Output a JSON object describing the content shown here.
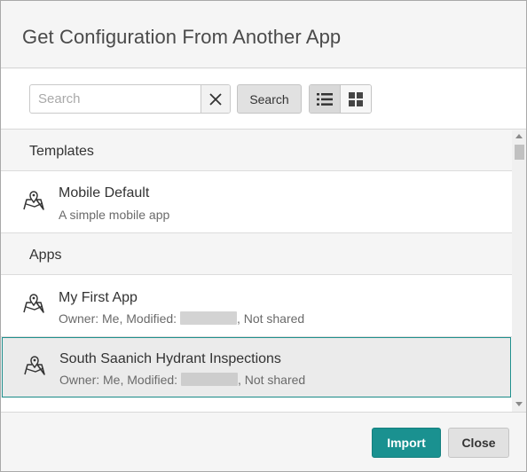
{
  "dialog": {
    "title": "Get Configuration From Another App"
  },
  "toolbar": {
    "search_placeholder": "Search",
    "search_value": "",
    "clear_icon": "close-x-icon",
    "search_label": "Search",
    "view_modes": [
      {
        "name": "list-view-icon",
        "active": true
      },
      {
        "name": "grid-view-icon",
        "active": false
      }
    ]
  },
  "sections": {
    "templates": {
      "label": "Templates",
      "items": [
        {
          "title": "Mobile Default",
          "subtitle": "A simple mobile app",
          "icon": "map-pin-icon"
        }
      ]
    },
    "apps": {
      "label": "Apps",
      "items": [
        {
          "title": "My First  App",
          "owner_prefix": "Owner: Me, Modified: ",
          "modified": "",
          "sharing": ", Not shared",
          "icon": "map-pin-icon",
          "selected": false
        },
        {
          "title": "South Saanich Hydrant Inspections",
          "owner_prefix": "Owner: Me, Modified: ",
          "modified": "",
          "sharing": ", Not shared",
          "icon": "map-pin-icon",
          "selected": true
        }
      ]
    }
  },
  "footer": {
    "import_label": "Import",
    "close_label": "Close"
  },
  "colors": {
    "accent": "#1a9190",
    "selected_border": "#1f8f8d"
  }
}
